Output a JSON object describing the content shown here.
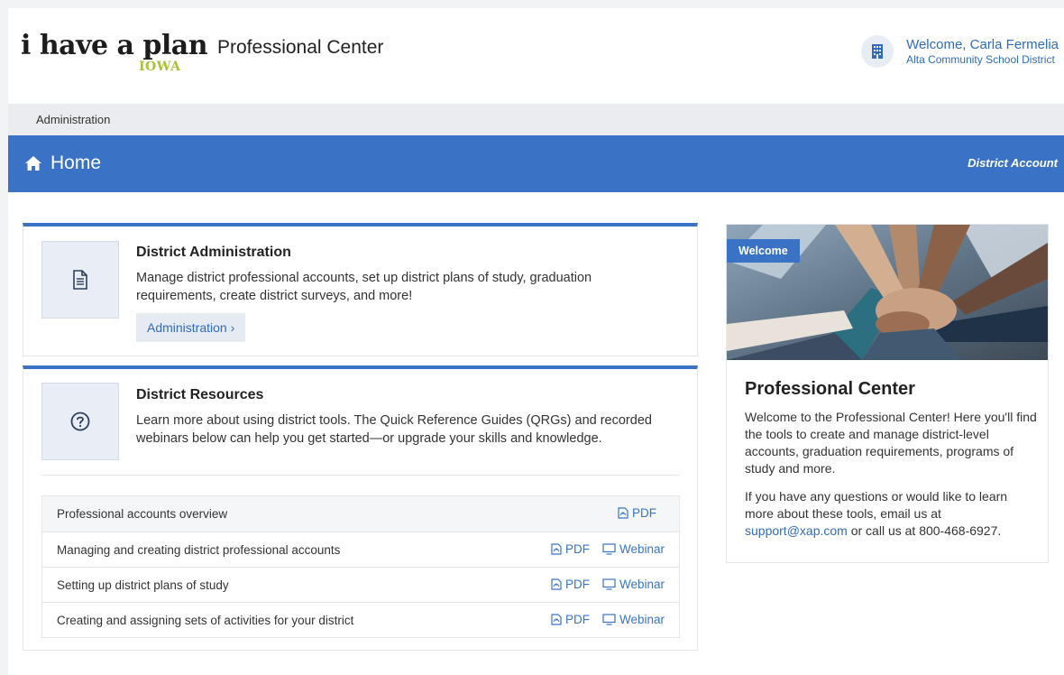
{
  "header": {
    "logo_text": "i have a plan",
    "logo_sub": "IOWA",
    "app_title": "Professional Center",
    "user_welcome": "Welcome, Carla Fermelia",
    "user_district": "Alta Community School District"
  },
  "subnav": {
    "item": "Administration"
  },
  "page_bar": {
    "title": "Home",
    "icon": "home-icon",
    "account_type": "District Account"
  },
  "district_admin": {
    "icon": "document-icon",
    "title": "District Administration",
    "description": "Manage district professional accounts, set up district plans of study, graduation requirements, create district surveys, and more!",
    "button": "Administration ›"
  },
  "district_resources": {
    "icon": "question-circle-icon",
    "title": "District Resources",
    "description": "Learn more about using district tools. The Quick Reference Guides (QRGs) and recorded webinars below can help you get started—or upgrade your skills and knowledge.",
    "rows": [
      {
        "name": "Professional accounts overview",
        "pdf": "PDF",
        "webinar": ""
      },
      {
        "name": "Managing and creating district professional accounts",
        "pdf": "PDF",
        "webinar": "Webinar"
      },
      {
        "name": "Setting up district plans of study",
        "pdf": "PDF",
        "webinar": "Webinar"
      },
      {
        "name": "Creating and assigning sets of activities for your district",
        "pdf": "PDF",
        "webinar": "Webinar"
      }
    ]
  },
  "welcome_card": {
    "tag": "Welcome",
    "title": "Professional Center",
    "para1": "Welcome to the Professional Center! Here you'll find the tools to create and manage district-level accounts, graduation requirements, programs of study and more.",
    "para2_prefix": "If you have any questions or would like to learn more about these tools, email us at ",
    "email": "support@xap.com",
    "para2_suffix": " or call us at 800-468-6927."
  },
  "colors": {
    "primary": "#3a73c6",
    "link": "#2f6bbf",
    "logo_accent": "#a8c23a"
  }
}
